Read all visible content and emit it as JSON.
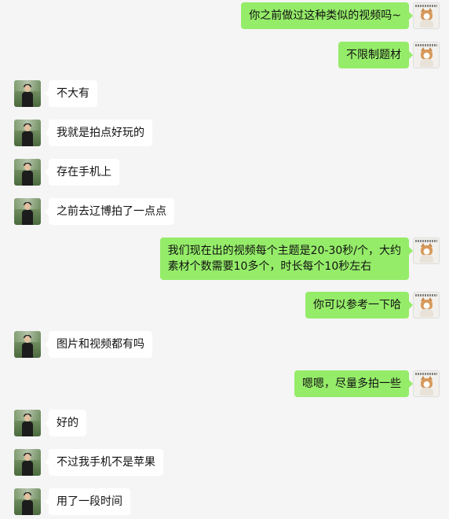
{
  "colors": {
    "background": "#f5f5f5",
    "sent_bubble": "#95ec69",
    "received_bubble": "#ffffff"
  },
  "messages": [
    {
      "side": "right",
      "avatar": "cat-avatar",
      "text": "你之前做过这种类似的视频吗~"
    },
    {
      "side": "right",
      "avatar": "cat-avatar",
      "text": "不限制题材"
    },
    {
      "side": "left",
      "avatar": "person-avatar",
      "text": "不大有"
    },
    {
      "side": "left",
      "avatar": "person-avatar",
      "text": "我就是拍点好玩的"
    },
    {
      "side": "left",
      "avatar": "person-avatar",
      "text": "存在手机上"
    },
    {
      "side": "left",
      "avatar": "person-avatar",
      "text": "之前去辽博拍了一点点"
    },
    {
      "side": "right",
      "avatar": "cat-avatar",
      "text": "我们现在出的视频每个主题是20-30秒/个，大约\n素材个数需要10多个，时长每个10秒左右"
    },
    {
      "side": "right",
      "avatar": "cat-avatar",
      "text": "你可以参考一下哈"
    },
    {
      "side": "left",
      "avatar": "person-avatar",
      "text": "图片和视频都有吗"
    },
    {
      "side": "right",
      "avatar": "cat-avatar",
      "text": "嗯嗯，尽量多拍一些"
    },
    {
      "side": "left",
      "avatar": "person-avatar",
      "text": "好的"
    },
    {
      "side": "left",
      "avatar": "person-avatar",
      "text": "不过我手机不是苹果"
    },
    {
      "side": "left",
      "avatar": "person-avatar",
      "text": "用了一段时间"
    }
  ]
}
